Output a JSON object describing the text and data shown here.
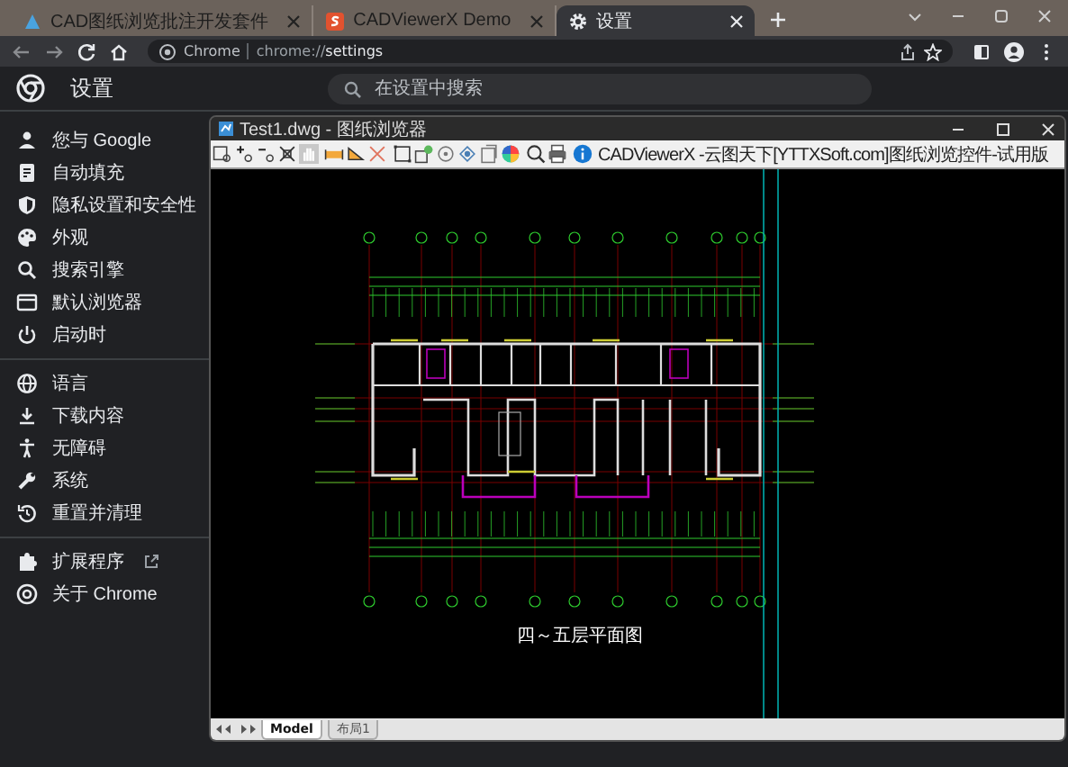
{
  "browser_tabs": [
    {
      "title": "CAD图纸浏览批注开发套件",
      "selected": false
    },
    {
      "title": "CADViewerX Demo",
      "selected": false
    },
    {
      "title": "设置",
      "selected": true
    }
  ],
  "address_bar": {
    "site": "Chrome",
    "url_prefix": "chrome://",
    "url_path": "settings"
  },
  "header": {
    "title": "设置",
    "search": {
      "placeholder": "在设置中搜索"
    }
  },
  "sidebar": {
    "groups": [
      [
        {
          "label": "您与 Google",
          "selected": false
        },
        {
          "label": "自动填充",
          "selected": false
        },
        {
          "label": "隐私设置和安全性",
          "selected": false
        },
        {
          "label": "外观",
          "selected": false
        },
        {
          "label": "搜索引擎",
          "selected": false
        },
        {
          "label": "默认浏览器",
          "selected": false
        },
        {
          "label": "启动时",
          "selected": false
        }
      ],
      [
        {
          "label": "语言",
          "selected": false
        },
        {
          "label": "下载内容",
          "selected": false
        },
        {
          "label": "无障碍",
          "selected": false
        },
        {
          "label": "系统",
          "selected": false
        },
        {
          "label": "重置并清理",
          "selected": false
        }
      ],
      [
        {
          "label": "扩展程序",
          "external": true,
          "selected": false
        },
        {
          "label": "关于 Chrome",
          "selected": false
        }
      ]
    ]
  },
  "cad_window": {
    "title": "Test1.dwg - 图纸浏览器",
    "toolbar_info": "CADViewerX -云图天下[YTTXSoft.com]图纸浏览控件-试用版",
    "drawing_title": "四～五层平面图",
    "layout_tabs": [
      {
        "label": "Model",
        "selected": true
      },
      {
        "label": "布局1",
        "selected": false
      }
    ]
  }
}
